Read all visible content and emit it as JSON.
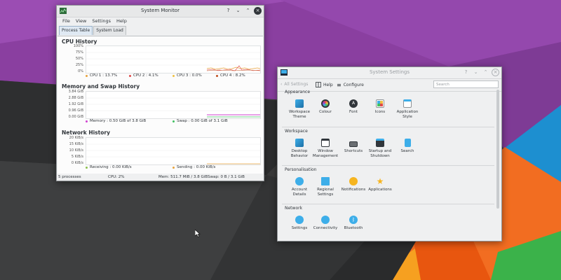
{
  "colors": {
    "accent": "#3daee9",
    "cpu1": "#e8a33c",
    "cpu2": "#e04848",
    "cpu3": "#f0c040",
    "cpu4": "#c05020",
    "memory": "#d040d0",
    "swap": "#40c060",
    "receiving": "#8ac04a",
    "sending": "#e8a33c"
  },
  "system_monitor": {
    "title": "System Monitor",
    "menus": [
      "File",
      "View",
      "Settings",
      "Help"
    ],
    "tabs": [
      "Process Table",
      "System Load"
    ],
    "cpu": {
      "title": "CPU History",
      "y_ticks": [
        "100%",
        "75%",
        "50%",
        "25%",
        "0%"
      ],
      "legend": [
        "CPU 1 : 13.7%",
        "CPU 2 : 4.1%",
        "CPU 3 : 0.0%",
        "CPU 4 : 8.2%"
      ]
    },
    "memory": {
      "title": "Memory and Swap History",
      "y_ticks": [
        "3.84 GiB",
        "2.88 GiB",
        "1.92 GiB",
        "0.96 GiB",
        "0.00 GiB"
      ],
      "legend": [
        "Memory : 0.50 GiB of 3.8 GiB",
        "Swap : 0.00 GiB of 3.1 GiB"
      ]
    },
    "network": {
      "title": "Network History",
      "y_ticks": [
        "20 KiB/s",
        "15 KiB/s",
        "10 KiB/s",
        "5 KiB/s",
        "0 KiB/s"
      ],
      "legend": [
        "Receiving : 0.00 KiB/s",
        "Sending : 0.00 KiB/s"
      ]
    },
    "status": {
      "processes": "5 processes",
      "cpu": "CPU: 2%",
      "mem": "Mem: 511.7 MiB / 3.8 GiB",
      "swap": "Swap: 0 B / 3.1 GiB"
    }
  },
  "system_settings": {
    "title": "System Settings",
    "toolbar": {
      "all_settings": "All Settings",
      "help": "Help",
      "configure": "Configure",
      "search_placeholder": "Search"
    },
    "categories": [
      {
        "name": "Appearance",
        "items": [
          {
            "label": "Workspace\nTheme",
            "icon": "workspace-theme-icon"
          },
          {
            "label": "Colour",
            "icon": "colour-icon"
          },
          {
            "label": "Font",
            "icon": "font-icon"
          },
          {
            "label": "Icons",
            "icon": "icons-icon"
          },
          {
            "label": "Application\nStyle",
            "icon": "application-style-icon"
          }
        ]
      },
      {
        "name": "Workspace",
        "items": [
          {
            "label": "Desktop\nBehavior",
            "icon": "desktop-behavior-icon"
          },
          {
            "label": "Window\nManagement",
            "icon": "window-management-icon"
          },
          {
            "label": "Shortcuts",
            "icon": "shortcuts-icon"
          },
          {
            "label": "Startup and\nShutdown",
            "icon": "startup-shutdown-icon"
          },
          {
            "label": "Search",
            "icon": "search-icon"
          }
        ]
      },
      {
        "name": "Personalisation",
        "items": [
          {
            "label": "Account\nDetails",
            "icon": "account-details-icon"
          },
          {
            "label": "Regional\nSettings",
            "icon": "regional-settings-icon"
          },
          {
            "label": "Notifications",
            "icon": "notifications-icon"
          },
          {
            "label": "Applications",
            "icon": "applications-icon"
          }
        ]
      },
      {
        "name": "Network",
        "items": [
          {
            "label": "Settings",
            "icon": "network-settings-icon"
          },
          {
            "label": "Connectivity",
            "icon": "connectivity-icon"
          },
          {
            "label": "Bluetooth",
            "icon": "bluetooth-icon"
          }
        ]
      }
    ]
  }
}
